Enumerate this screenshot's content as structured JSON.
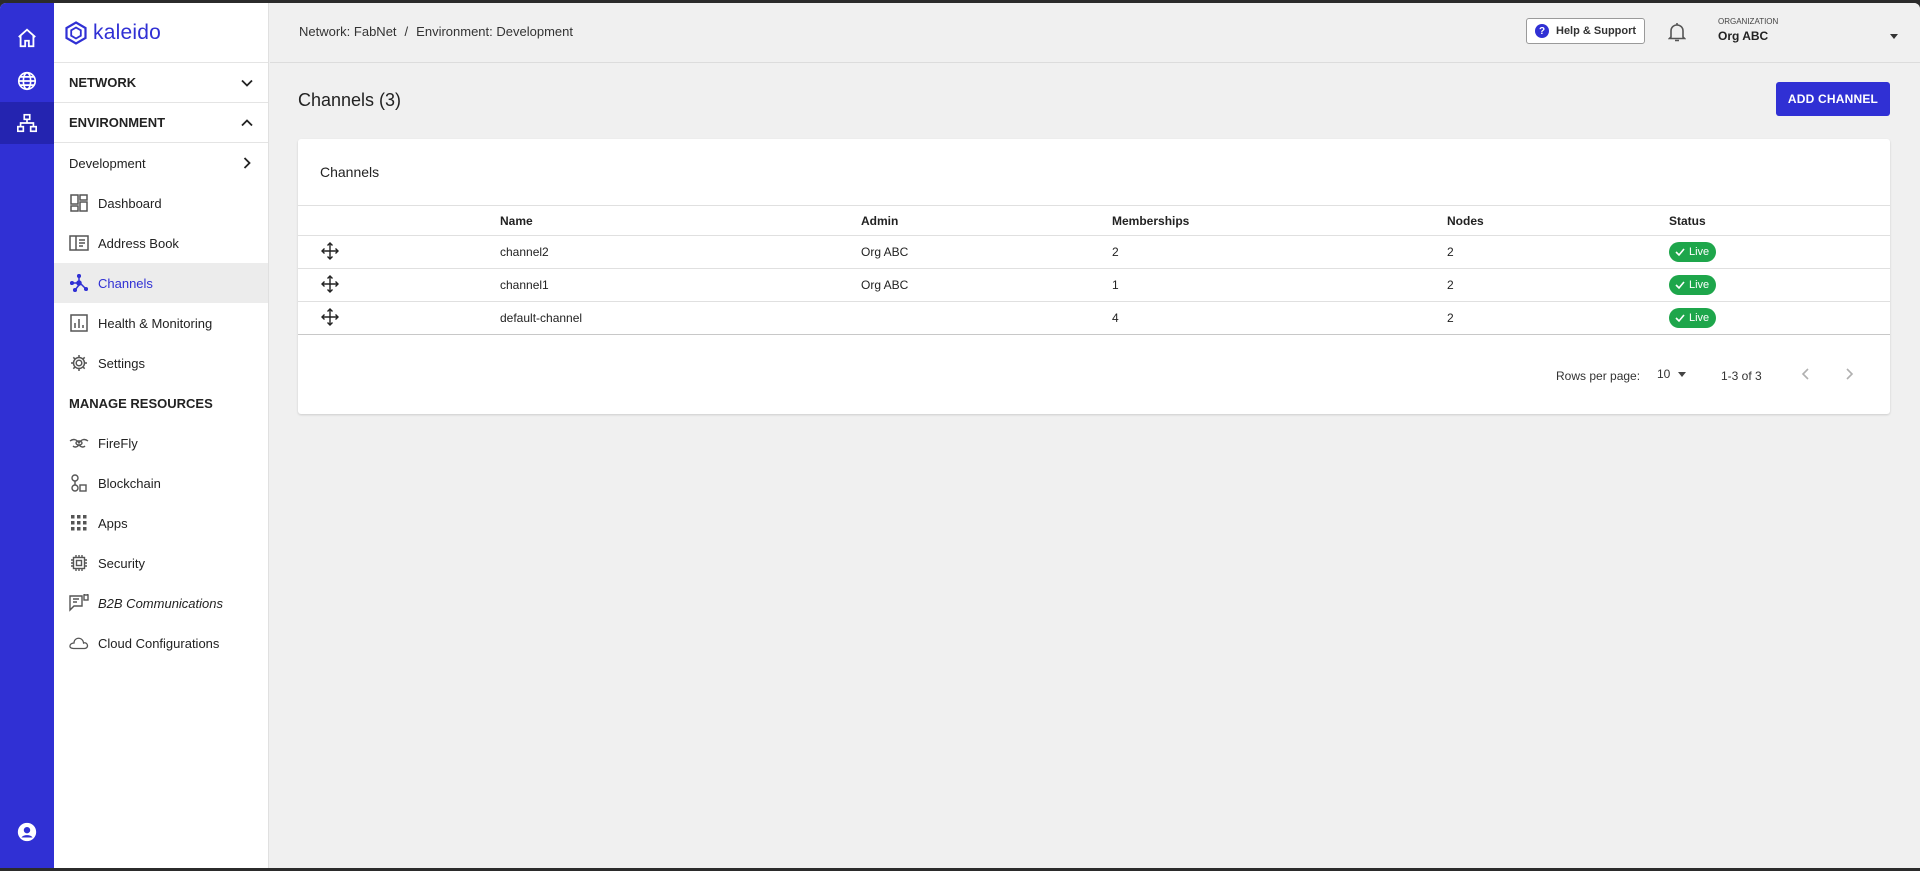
{
  "rail": {
    "items": [
      {
        "icon": "home-icon"
      },
      {
        "icon": "globe-icon"
      },
      {
        "icon": "network-icon"
      },
      {
        "icon": "account-icon"
      }
    ]
  },
  "sidebar": {
    "logo": "kaleido",
    "network_label": "NETWORK",
    "environment_label": "ENVIRONMENT",
    "environment_selected": "Development",
    "env_items": [
      {
        "label": "Dashboard",
        "icon": "dashboard-icon"
      },
      {
        "label": "Address Book",
        "icon": "address-book-icon"
      },
      {
        "label": "Channels",
        "icon": "channels-icon"
      },
      {
        "label": "Health & Monitoring",
        "icon": "chart-icon"
      },
      {
        "label": "Settings",
        "icon": "gear-icon"
      }
    ],
    "manage_label": "MANAGE RESOURCES",
    "manage_items": [
      {
        "label": "FireFly",
        "icon": "firefly-icon"
      },
      {
        "label": "Blockchain",
        "icon": "blockchain-icon"
      },
      {
        "label": "Apps",
        "icon": "apps-grid-icon"
      },
      {
        "label": "Security",
        "icon": "chip-icon"
      },
      {
        "label": "B2B Communications",
        "icon": "b2b-icon"
      },
      {
        "label": "Cloud Configurations",
        "icon": "cloud-icon"
      }
    ]
  },
  "topbar": {
    "crumb_network": "Network: FabNet",
    "crumb_sep": "/",
    "crumb_environment": "Environment: Development",
    "help_label": "Help & Support",
    "help_glyph": "?",
    "org_caption": "ORGANIZATION",
    "org_name": "Org ABC"
  },
  "main": {
    "title": "Channels (3)",
    "add_button": "ADD CHANNEL",
    "card_title": "Channels",
    "columns": [
      "Name",
      "Admin",
      "Memberships",
      "Nodes",
      "Status"
    ],
    "rows": [
      {
        "name": "channel2",
        "admin": "Org ABC",
        "memberships": "2",
        "nodes": "2",
        "status": "Live"
      },
      {
        "name": "channel1",
        "admin": "Org ABC",
        "memberships": "1",
        "nodes": "2",
        "status": "Live"
      },
      {
        "name": "default-channel",
        "admin": "",
        "memberships": "4",
        "nodes": "2",
        "status": "Live"
      }
    ],
    "rows_per_page_label": "Rows per page:",
    "rows_per_page": "10",
    "range": "1-3 of 3"
  },
  "colors": {
    "brand": "#3030d4",
    "live": "#1ea64b"
  }
}
